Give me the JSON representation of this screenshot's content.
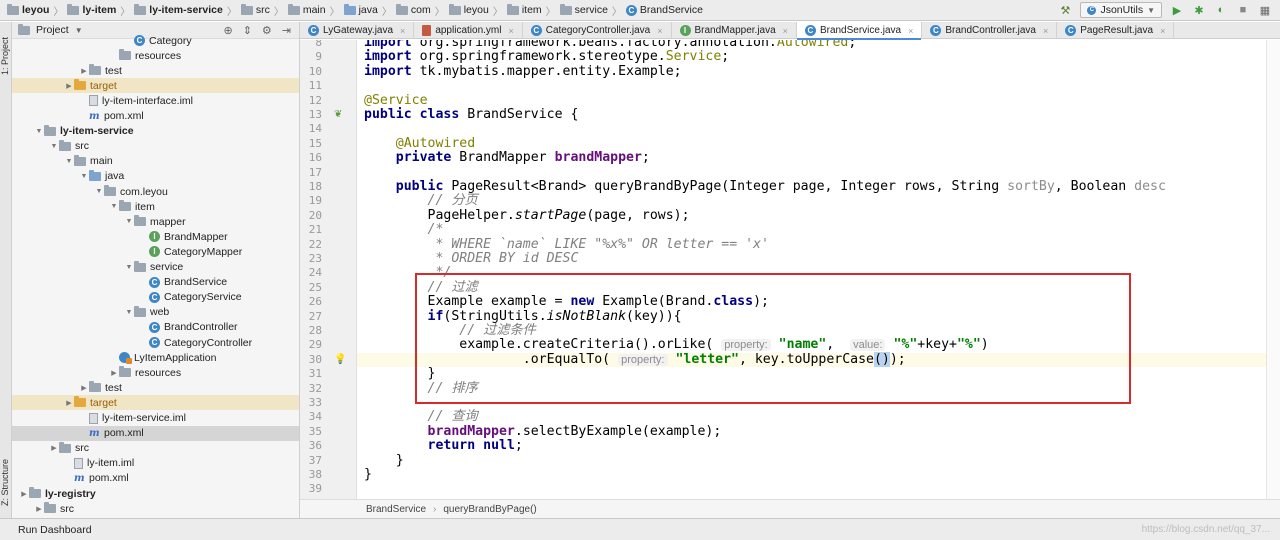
{
  "navbar": {
    "crumbs": [
      {
        "label": "leyou",
        "bold": true,
        "icon": "folder"
      },
      {
        "label": "ly-item",
        "bold": true,
        "icon": "folder"
      },
      {
        "label": "ly-item-service",
        "bold": true,
        "icon": "folder"
      },
      {
        "label": "src",
        "bold": false,
        "icon": "folder"
      },
      {
        "label": "main",
        "bold": false,
        "icon": "folder"
      },
      {
        "label": "java",
        "bold": false,
        "icon": "folder-blue"
      },
      {
        "label": "com",
        "bold": false,
        "icon": "folder"
      },
      {
        "label": "leyou",
        "bold": false,
        "icon": "folder"
      },
      {
        "label": "item",
        "bold": false,
        "icon": "folder"
      },
      {
        "label": "service",
        "bold": false,
        "icon": "folder"
      },
      {
        "label": "BrandService",
        "bold": false,
        "icon": "class"
      }
    ],
    "run_config": "JsonUtils",
    "icons": [
      "hammer-icon",
      "run-icon",
      "debug-icon",
      "coverage-icon",
      "stop-icon",
      "structure-icon"
    ]
  },
  "left_strip": {
    "project_tab": "1: Project",
    "structure_tab": "Z: Structure"
  },
  "project_panel": {
    "title": "Project",
    "tree": [
      {
        "label": "Category",
        "indent": 8,
        "icon": "class",
        "arrow": ""
      },
      {
        "label": "resources",
        "indent": 7,
        "icon": "folder",
        "arrow": ""
      },
      {
        "label": "test",
        "indent": 5,
        "icon": "folder",
        "arrow": "▶"
      },
      {
        "label": "target",
        "indent": 4,
        "icon": "folder-orange",
        "arrow": "▶",
        "style": "hl"
      },
      {
        "label": "ly-item-interface.iml",
        "indent": 5,
        "icon": "file",
        "arrow": ""
      },
      {
        "label": "pom.xml",
        "indent": 5,
        "icon": "m",
        "arrow": ""
      },
      {
        "label": "ly-item-service",
        "indent": 2,
        "icon": "folder",
        "arrow": "▼",
        "bold": true
      },
      {
        "label": "src",
        "indent": 3,
        "icon": "folder",
        "arrow": "▼"
      },
      {
        "label": "main",
        "indent": 4,
        "icon": "folder",
        "arrow": "▼"
      },
      {
        "label": "java",
        "indent": 5,
        "icon": "folder-blue",
        "arrow": "▼"
      },
      {
        "label": "com.leyou",
        "indent": 6,
        "icon": "folder",
        "arrow": "▼"
      },
      {
        "label": "item",
        "indent": 7,
        "icon": "folder",
        "arrow": "▼"
      },
      {
        "label": "mapper",
        "indent": 8,
        "icon": "folder",
        "arrow": "▼"
      },
      {
        "label": "BrandMapper",
        "indent": 9,
        "icon": "iface",
        "arrow": ""
      },
      {
        "label": "CategoryMapper",
        "indent": 9,
        "icon": "iface",
        "arrow": ""
      },
      {
        "label": "service",
        "indent": 8,
        "icon": "folder",
        "arrow": "▼"
      },
      {
        "label": "BrandService",
        "indent": 9,
        "icon": "class",
        "arrow": ""
      },
      {
        "label": "CategoryService",
        "indent": 9,
        "icon": "class",
        "arrow": ""
      },
      {
        "label": "web",
        "indent": 8,
        "icon": "folder",
        "arrow": "▼"
      },
      {
        "label": "BrandController",
        "indent": 9,
        "icon": "class",
        "arrow": ""
      },
      {
        "label": "CategoryController",
        "indent": 9,
        "icon": "class",
        "arrow": ""
      },
      {
        "label": "LyItemApplication",
        "indent": 7,
        "icon": "app",
        "arrow": ""
      },
      {
        "label": "resources",
        "indent": 7,
        "icon": "folder",
        "arrow": "▶"
      },
      {
        "label": "test",
        "indent": 5,
        "icon": "folder",
        "arrow": "▶"
      },
      {
        "label": "target",
        "indent": 4,
        "icon": "folder-orange",
        "arrow": "▶",
        "style": "hl"
      },
      {
        "label": "ly-item-service.iml",
        "indent": 5,
        "icon": "file",
        "arrow": ""
      },
      {
        "label": "pom.xml",
        "indent": 5,
        "icon": "m",
        "arrow": "",
        "style": "sel"
      },
      {
        "label": "src",
        "indent": 3,
        "icon": "folder",
        "arrow": "▶"
      },
      {
        "label": "ly-item.iml",
        "indent": 4,
        "icon": "file",
        "arrow": ""
      },
      {
        "label": "pom.xml",
        "indent": 4,
        "icon": "m",
        "arrow": ""
      },
      {
        "label": "ly-registry",
        "indent": 1,
        "icon": "folder",
        "arrow": "▶",
        "bold": true
      },
      {
        "label": "src",
        "indent": 2,
        "icon": "folder",
        "arrow": "▶"
      }
    ]
  },
  "tabs": [
    {
      "label": "LyGateway.java",
      "icon": "class",
      "active": false
    },
    {
      "label": "application.yml",
      "icon": "yml",
      "active": false
    },
    {
      "label": "CategoryController.java",
      "icon": "class",
      "active": false
    },
    {
      "label": "BrandMapper.java",
      "icon": "iface",
      "active": false
    },
    {
      "label": "BrandService.java",
      "icon": "class",
      "active": true
    },
    {
      "label": "BrandController.java",
      "icon": "class",
      "active": false
    },
    {
      "label": "PageResult.java",
      "icon": "class",
      "active": false
    }
  ],
  "editor": {
    "line_numbers": [
      "8",
      "9",
      "10",
      "11",
      "12",
      "13",
      "14",
      "15",
      "16",
      "17",
      "18",
      "19",
      "20",
      "21",
      "22",
      "23",
      "24",
      "25",
      "26",
      "27",
      "28",
      "29",
      "30",
      "31",
      "32",
      "33",
      "34",
      "35",
      "36",
      "37",
      "38",
      "39"
    ],
    "current_line": 30,
    "code": [
      "import org.springframework.beans.factory.annotation.Autowired;",
      "import org.springframework.stereotype.Service;",
      "import tk.mybatis.mapper.entity.Example;",
      "",
      "@Service",
      "public class BrandService {",
      "",
      "    @Autowired",
      "    private BrandMapper brandMapper;",
      "",
      "    public PageResult<Brand> queryBrandByPage(Integer page, Integer rows, String sortBy, Boolean desc",
      "        // 分页",
      "        PageHelper.startPage(page, rows);",
      "        /*",
      "         * WHERE `name` LIKE \"%x%\" OR letter == 'x'",
      "         * ORDER BY id DESC",
      "         */",
      "        // 过滤",
      "        Example example = new Example(Brand.class);",
      "        if(StringUtils.isNotBlank(key)){",
      "            // 过滤条件",
      "            example.createCriteria().orLike( property: \"name\",  value: \"%\"+key+\"%\")",
      "                    .orEqualTo( property: \"letter\", key.toUpperCase());",
      "        }",
      "        // 排序",
      "",
      "        // 查询",
      "        brandMapper.selectByExample(example);",
      "        return null;",
      "    }",
      "}",
      ""
    ]
  },
  "editor_crumb": {
    "class": "BrandService",
    "method": "queryBrandByPage()"
  },
  "bottom": {
    "run_dashboard": "Run Dashboard",
    "watermark": "https://blog.csdn.net/qq_37..."
  }
}
